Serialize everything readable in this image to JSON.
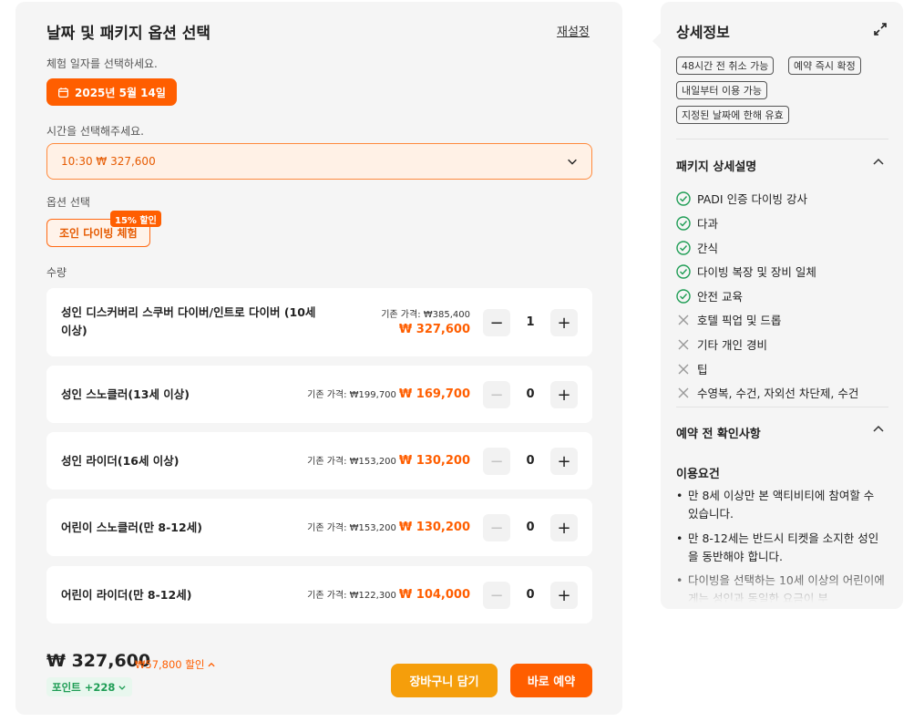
{
  "booking": {
    "title": "날짜 및 패키지 옵션 선택",
    "reset_label": "재설정",
    "date_section_label": "체험 일자를 선택하세요.",
    "selected_date": "2025년 5월 14일",
    "time_section_label": "시간을 선택해주세요.",
    "selected_time": "10:30 ₩ 327,600",
    "option_section_label": "옵션 선택",
    "option_label": "조인 다이빙 체험",
    "option_discount_badge": "15% 할인",
    "quantity_section_label": "수량",
    "quantities": [
      {
        "name": "성인 디스커버리 스쿠버 다이버/인트로 다이버 (10세 이상)",
        "base_price": "기존 가격: ₩385,400",
        "sale_price": "₩ 327,600",
        "qty": "1"
      },
      {
        "name": "성인 스노클러(13세 이상)",
        "base_price": "기존 가격: ₩199,700",
        "sale_price": "₩ 169,700",
        "qty": "0"
      },
      {
        "name": "성인 라이더(16세 이상)",
        "base_price": "기존 가격: ₩153,200",
        "sale_price": "₩ 130,200",
        "qty": "0"
      },
      {
        "name": "어린이 스노클러(만 8-12세)",
        "base_price": "기존 가격: ₩153,200",
        "sale_price": "₩ 130,200",
        "qty": "0"
      },
      {
        "name": "어린이 라이더(만 8-12세)",
        "base_price": "기존 가격: ₩122,300",
        "sale_price": "₩ 104,000",
        "qty": "0"
      }
    ],
    "stepper_minus": "−",
    "stepper_plus": "+",
    "total_price": "₩ 327,600",
    "total_discount": "₩57,800 할인",
    "points": "포인트 +228",
    "cart_label": "장바구니 담기",
    "book_label": "바로 예약"
  },
  "details": {
    "title": "상세정보",
    "tags": [
      "48시간 전 취소 가능",
      "예약 즉시 확정",
      "내일부터 이용 가능",
      "지정된 날짜에 한해 유효"
    ],
    "package_section_title": "패키지 상세설명",
    "included": [
      "PADI 인증 다이빙 강사",
      "다과",
      "간식",
      "다이빙 복장 및 장비 일체",
      "안전 교육"
    ],
    "excluded": [
      "호텔 픽업 및 드롭",
      "기타 개인 경비",
      "팁",
      "수영복, 수건, 자외선 차단제, 수건"
    ],
    "notice_section_title": "예약 전 확인사항",
    "requirements_title": "이용요건",
    "requirements": [
      "만 8세 이상만 본 액티비티에 참여할 수 있습니다.",
      "만 8-12세는 반드시 티켓을 소지한 성인을 동반해야 합니다.",
      "다이빙을 선택하는 10세 이상의 어린이에게는 성인과 동일한 요금이 부"
    ]
  },
  "colors": {
    "accent": "#ff5e00",
    "cart": "#f59e0b",
    "check_green": "#1f9d55",
    "panel_bg": "#f5f5f5"
  },
  "icons": {
    "date": "calendar-icon",
    "time_dropdown": "chevron-down-icon",
    "expand": "expand-icon",
    "collapse": "chevron-up-icon",
    "included": "check-circle-icon",
    "excluded": "x-icon"
  }
}
